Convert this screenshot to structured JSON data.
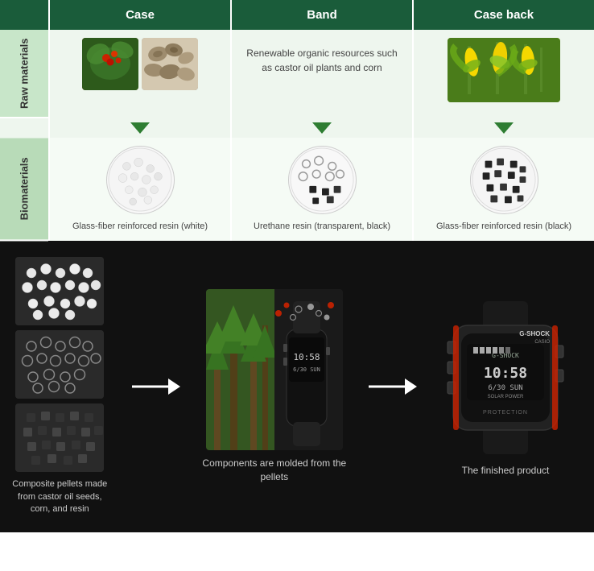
{
  "header": {
    "col1": "Case",
    "col2": "Band",
    "col3": "Case back"
  },
  "rows": {
    "rawMaterials": {
      "label": "Raw materials",
      "band_text": "Renewable organic resources such as castor oil plants and corn"
    },
    "biomaterials": {
      "label": "Biomaterials",
      "case_label": "Glass-fiber reinforced resin (white)",
      "band_label": "Urethane resin (transparent, black)",
      "caseback_label": "Glass-fiber reinforced resin (black)"
    }
  },
  "bottom": {
    "pellet_caption": "Composite pellets made from castor oil seeds, corn, and resin",
    "middle_caption": "Components are molded from the pellets",
    "finished_caption": "The finished product"
  }
}
